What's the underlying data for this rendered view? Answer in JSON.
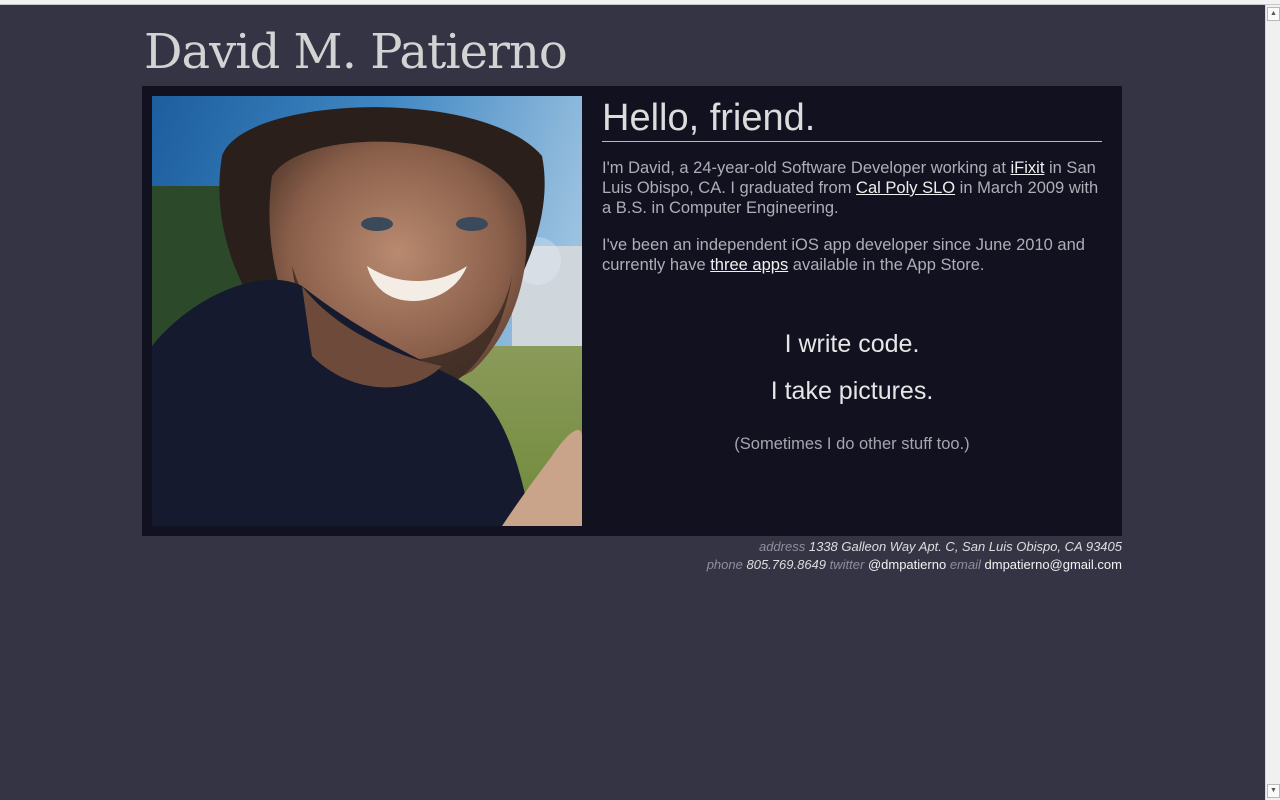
{
  "header": {
    "title": "David M. Patierno"
  },
  "photo": {
    "alt_name": "portrait-photo"
  },
  "intro": {
    "greeting": "Hello, friend.",
    "p1_text1": "I'm David, a 24-year-old Software Developer working at ",
    "p1_link1": "iFixit",
    "p1_text2": " in San Luis Obispo, CA. I graduated from ",
    "p1_link2": "Cal Poly SLO",
    "p1_text3": " in March 2009 with a B.S. in Computer Engineering.",
    "p2_text1": "I've been an independent iOS app developer since June 2010 and currently have ",
    "p2_link": "three apps",
    "p2_text2": " available in the App Store."
  },
  "taglines": {
    "line1": "I write code.",
    "line2": "I take pictures.",
    "aside": "(Sometimes I do other stuff too.)"
  },
  "footer": {
    "address_label": "address",
    "address_value": "1338 Galleon Way Apt. C, San Luis Obispo, CA 93405",
    "phone_label": "phone",
    "phone_value": "805.769.8649",
    "twitter_label": "twitter",
    "twitter_value": "@dmpatierno",
    "email_label": "email",
    "email_value": "dmpatierno@gmail.com"
  },
  "colors": {
    "page_background": "#353445",
    "box_background": "#121120",
    "link": "#f0f0f0"
  }
}
